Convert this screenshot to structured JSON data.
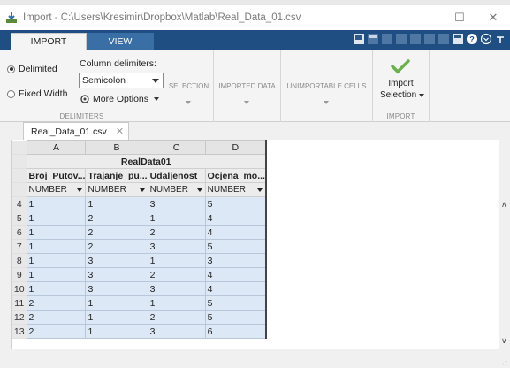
{
  "window": {
    "title": "Import - C:\\Users\\Kresimir\\Dropbox\\Matlab\\Real_Data_01.csv",
    "minimize": "—",
    "maximize": "☐",
    "close": "✕"
  },
  "ribbon_tabs": [
    {
      "label": "IMPORT",
      "active": true
    },
    {
      "label": "VIEW",
      "active": false
    }
  ],
  "delimiters": {
    "delimited_label": "Delimited",
    "fixed_width_label": "Fixed Width",
    "selected": "Delimited",
    "column_delimiters_label": "Column delimiters:",
    "delimiter_value": "Semicolon",
    "more_options_label": "More Options",
    "group_label": "DELIMITERS"
  },
  "sections": {
    "selection": "SELECTION",
    "imported_data": "IMPORTED DATA",
    "unimportable_cells": "UNIMPORTABLE CELLS"
  },
  "import_group": {
    "button_line1": "Import",
    "button_line2": "Selection",
    "group_label": "IMPORT"
  },
  "file_tab": {
    "name": "Real_Data_01.csv",
    "close": "✕"
  },
  "grid": {
    "column_letters": [
      "A",
      "B",
      "C",
      "D"
    ],
    "variable_group": "RealData01",
    "variable_names": [
      "Broj_Putov...",
      "Trajanje_pu...",
      "Udaljenost",
      "Ocjena_mo..."
    ],
    "variable_types": [
      "NUMBER",
      "NUMBER",
      "NUMBER",
      "NUMBER"
    ],
    "rows": [
      {
        "n": "4",
        "cells": [
          "1",
          "1",
          "3",
          "5"
        ]
      },
      {
        "n": "5",
        "cells": [
          "1",
          "2",
          "1",
          "4"
        ]
      },
      {
        "n": "6",
        "cells": [
          "1",
          "2",
          "2",
          "4"
        ]
      },
      {
        "n": "7",
        "cells": [
          "1",
          "2",
          "3",
          "5"
        ]
      },
      {
        "n": "8",
        "cells": [
          "1",
          "3",
          "1",
          "3"
        ]
      },
      {
        "n": "9",
        "cells": [
          "1",
          "3",
          "2",
          "4"
        ]
      },
      {
        "n": "10",
        "cells": [
          "1",
          "3",
          "3",
          "4"
        ]
      },
      {
        "n": "11",
        "cells": [
          "2",
          "1",
          "1",
          "5"
        ]
      },
      {
        "n": "12",
        "cells": [
          "2",
          "1",
          "2",
          "5"
        ]
      },
      {
        "n": "13",
        "cells": [
          "2",
          "1",
          "3",
          "6"
        ]
      }
    ]
  },
  "colors": {
    "tab_bar": "#1f4f82",
    "selected_cell": "#dce8f5",
    "import_check": "#6ab04c"
  }
}
